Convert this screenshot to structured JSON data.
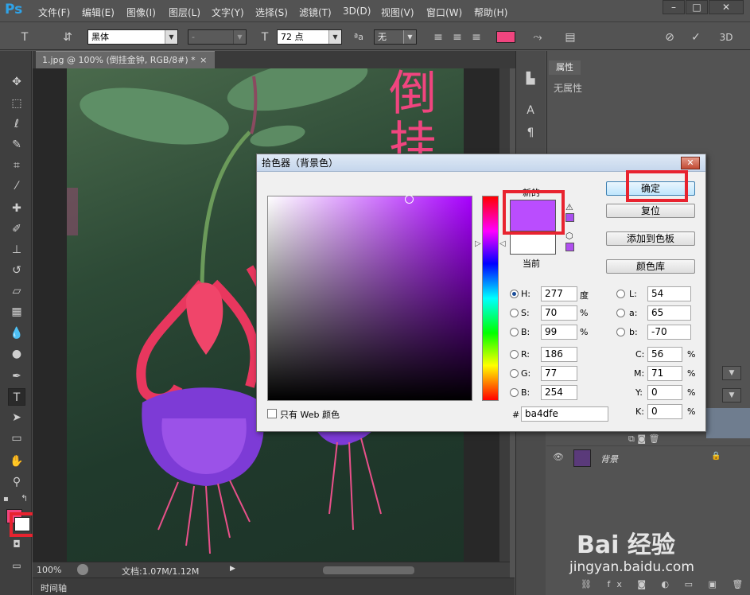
{
  "app": {
    "logo": "Ps"
  },
  "menu": [
    "文件(F)",
    "编辑(E)",
    "图像(I)",
    "图层(L)",
    "文字(Y)",
    "选择(S)",
    "滤镜(T)",
    "3D(D)",
    "视图(V)",
    "窗口(W)",
    "帮助(H)"
  ],
  "window_controls": {
    "minimize": "–",
    "maximize": "□",
    "close": "✕"
  },
  "options": {
    "font_family": "黑体",
    "font_style": "-",
    "font_size": "72 点",
    "aa_label": "ªa",
    "aa_value": "无",
    "text_color": "#f0457f",
    "three_d": "3D"
  },
  "document_tab": {
    "title": "1.jpg @ 100% (倒挂金钟, RGB/8#) *",
    "close": "×"
  },
  "canvas_text": {
    "line1": "倒",
    "line2": "挂"
  },
  "status": {
    "zoom": "100%",
    "doc_info": "文档:1.07M/1.12M"
  },
  "timeline_label": "时间轴",
  "properties_panel": {
    "tab": "属性",
    "empty_text": "无属性"
  },
  "layers": [
    {
      "name": "背景"
    }
  ],
  "colors": {
    "foreground": "#f0457f",
    "background": "#ffffff",
    "new_color": "#ba4dfe",
    "current_color": "#ffffff",
    "highlight": "#e8232f"
  },
  "dialog": {
    "title": "拾色器（背景色）",
    "close": "✕",
    "new_label": "新的",
    "current_label": "当前",
    "buttons": {
      "ok": "确定",
      "reset": "复位",
      "add_swatch": "添加到色板",
      "color_library": "颜色库"
    },
    "web_only_label": "只有 Web 颜色",
    "fields": {
      "H": {
        "label": "H:",
        "value": "277",
        "unit": "度"
      },
      "S": {
        "label": "S:",
        "value": "70",
        "unit": "%"
      },
      "B": {
        "label": "B:",
        "value": "99",
        "unit": "%"
      },
      "R": {
        "label": "R:",
        "value": "186"
      },
      "G": {
        "label": "G:",
        "value": "77"
      },
      "Bl": {
        "label": "B:",
        "value": "254"
      },
      "L": {
        "label": "L:",
        "value": "54"
      },
      "a": {
        "label": "a:",
        "value": "65"
      },
      "b": {
        "label": "b:",
        "value": "-70"
      },
      "C": {
        "label": "C:",
        "value": "56",
        "unit": "%"
      },
      "M": {
        "label": "M:",
        "value": "71",
        "unit": "%"
      },
      "Y": {
        "label": "Y:",
        "value": "0",
        "unit": "%"
      },
      "K": {
        "label": "K:",
        "value": "0",
        "unit": "%"
      }
    },
    "hex_label": "#",
    "hex_value": "ba4dfe"
  },
  "watermark": {
    "brand": "Bai  经验",
    "url": "jingyan.baidu.com"
  }
}
